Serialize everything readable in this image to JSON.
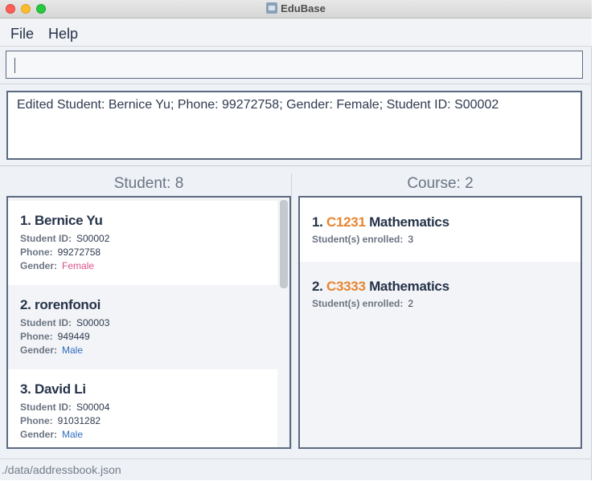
{
  "window": {
    "title": "EduBase"
  },
  "menu": {
    "file": "File",
    "help": "Help"
  },
  "command": {
    "value": ""
  },
  "result": {
    "text": "Edited Student: Bernice Yu; Phone: 99272758; Gender: Female; Student ID: S00002"
  },
  "students": {
    "header": "Student: 8",
    "labels": {
      "student_id": "Student ID:",
      "phone": "Phone:",
      "gender": "Gender:"
    },
    "items": [
      {
        "index": "1.",
        "name": "Bernice Yu",
        "student_id": "S00002",
        "phone": "99272758",
        "gender": "Female"
      },
      {
        "index": "2.",
        "name": "rorenfonoi",
        "student_id": "S00003",
        "phone": "949449",
        "gender": "Male"
      },
      {
        "index": "3.",
        "name": "David Li",
        "student_id": "S00004",
        "phone": "91031282",
        "gender": "Male"
      }
    ]
  },
  "courses": {
    "header": "Course: 2",
    "enrolled_label": "Student(s) enrolled:",
    "items": [
      {
        "index": "1.",
        "code": "C1231",
        "name": "Mathematics",
        "enrolled": "3"
      },
      {
        "index": "2.",
        "code": "C3333",
        "name": "Mathematics",
        "enrolled": "2"
      }
    ]
  },
  "status": {
    "path": "./data/addressbook.json"
  },
  "colors": {
    "accent_code": "#e8852f",
    "female": "#d94f86",
    "male": "#2f6cc2",
    "border": "#5b6a80"
  }
}
